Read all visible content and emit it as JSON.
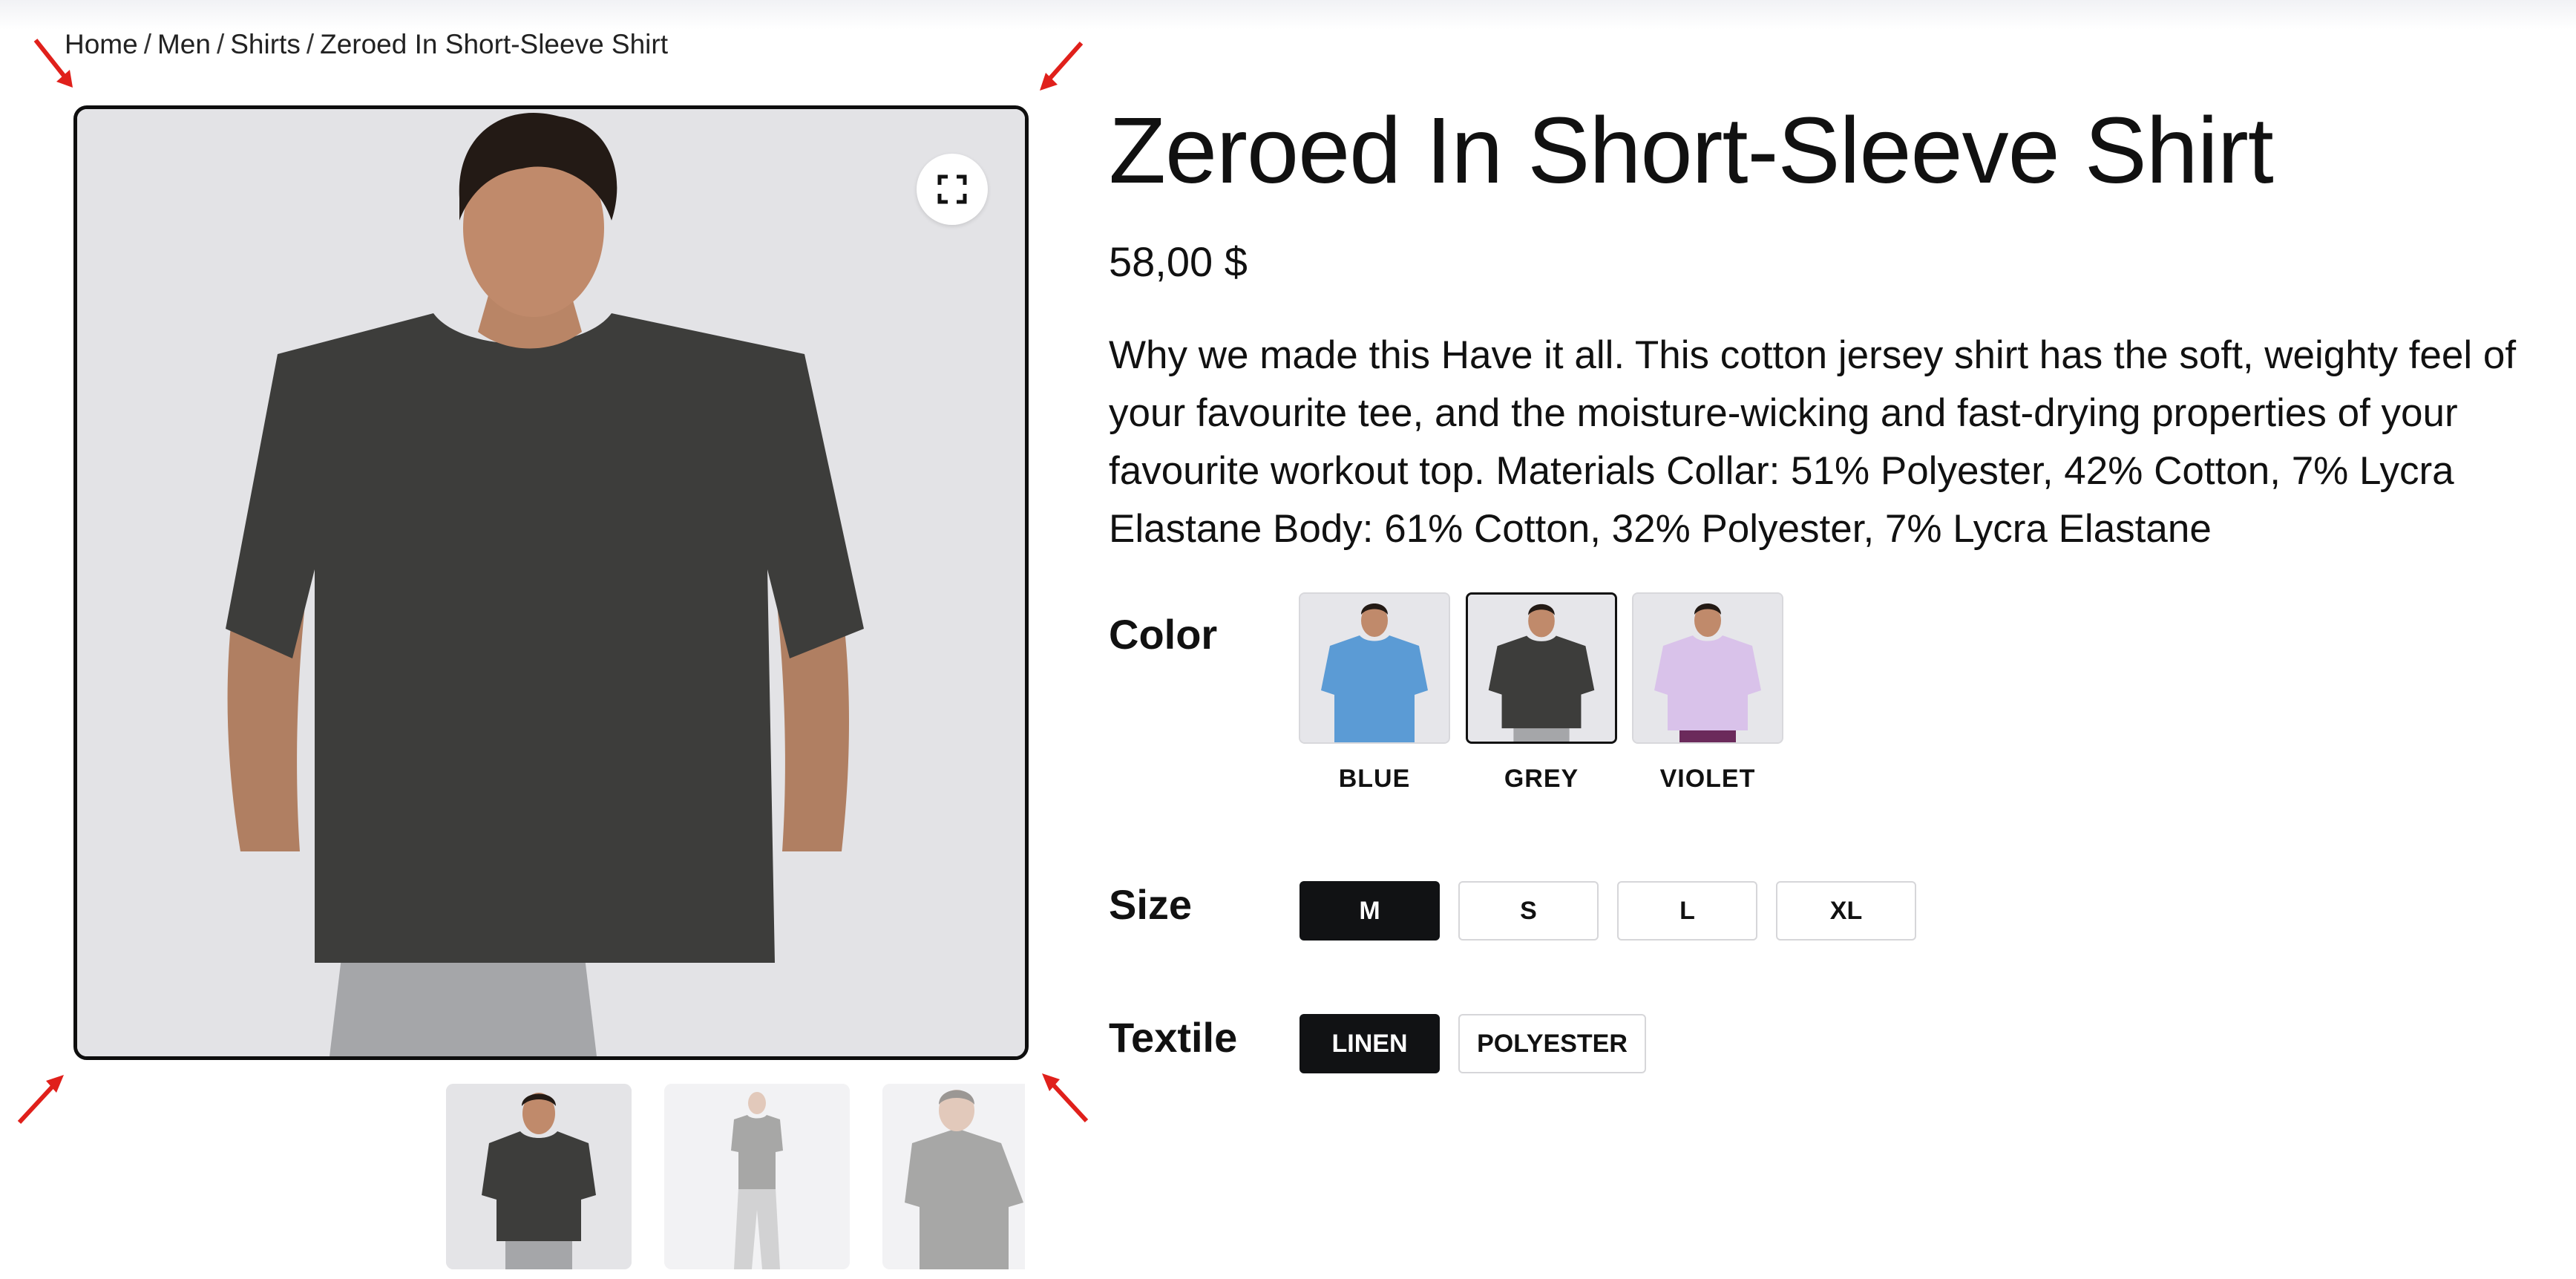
{
  "breadcrumb": {
    "items": [
      "Home",
      "Men",
      "Shirts",
      "Zeroed In Short-Sleeve Shirt"
    ],
    "separator": "/"
  },
  "product": {
    "title": "Zeroed In Short-Sleeve Shirt",
    "price": "58,00 $",
    "description": "Why we made this Have it all. This cotton jersey shirt has the soft, weighty feel of your favourite tee, and the moisture-wicking and fast-drying properties of your favourite workout top. Materials Collar: 51% Polyester, 42% Cotton, 7% Lycra Elastane Body: 61% Cotton, 32% Polyester, 7% Lycra Elastane"
  },
  "gallery": {
    "expand_icon": "expand-icon",
    "thumbnails": [
      "front-view",
      "full-body-view",
      "back-view"
    ],
    "selected_thumbnail": 0
  },
  "options": {
    "color": {
      "label": "Color",
      "values": [
        {
          "name": "BLUE",
          "shirt_color": "#5b9bd5"
        },
        {
          "name": "GREY",
          "shirt_color": "#3d3d3b"
        },
        {
          "name": "VIOLET",
          "shirt_color": "#d9c2ea"
        }
      ],
      "selected": "GREY"
    },
    "size": {
      "label": "Size",
      "values": [
        "M",
        "S",
        "L",
        "XL"
      ],
      "selected": "M"
    },
    "textile": {
      "label": "Textile",
      "values": [
        "LINEN",
        "POLYESTER"
      ],
      "selected": "LINEN"
    }
  },
  "colors": {
    "selected_bg": "#111214",
    "border": "#d6d6d9",
    "annotation_arrow": "#e0201b"
  }
}
